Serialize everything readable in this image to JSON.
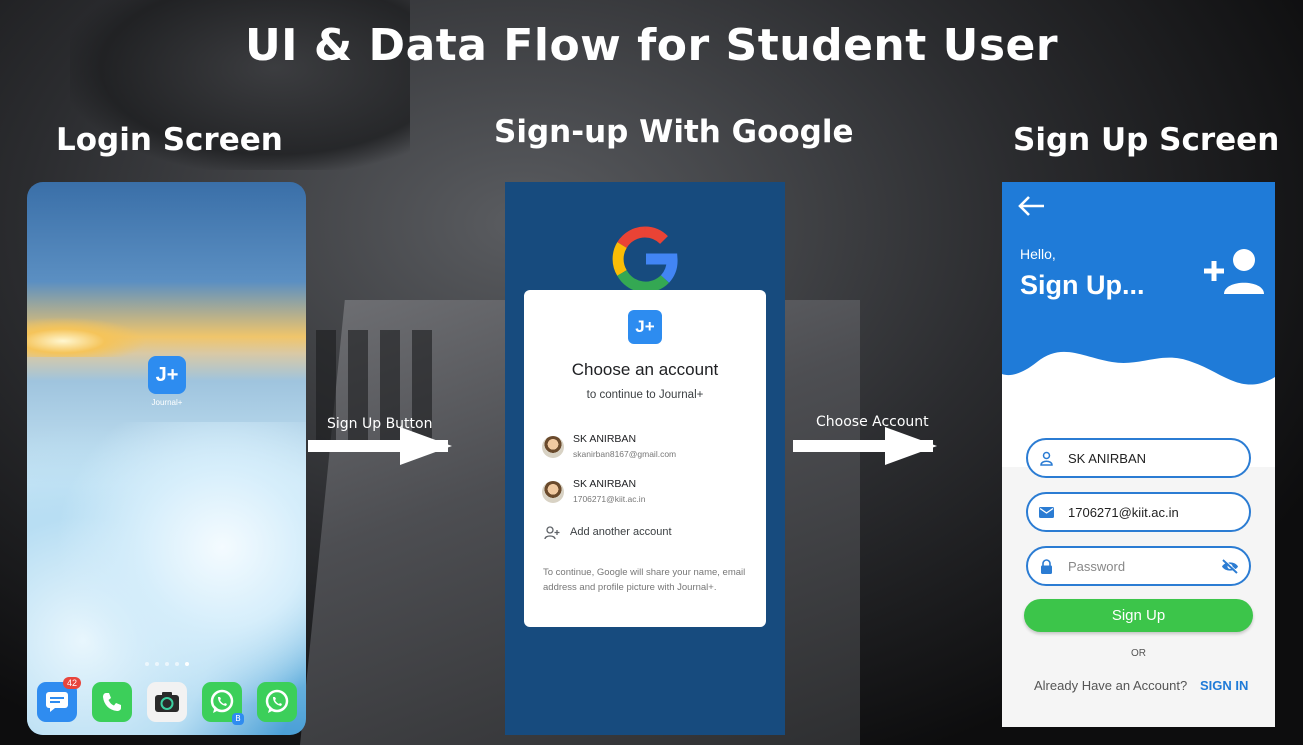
{
  "title": "UI & Data Flow for Student User",
  "sections": {
    "login": "Login Screen",
    "google": "Sign-up With Google",
    "signup": "Sign Up Screen"
  },
  "arrows": {
    "first_label": "Sign Up Button",
    "second_label": "Choose Account"
  },
  "home_screen": {
    "app_icon_text": "J+",
    "app_label": "Journal+",
    "messages_badge": "42",
    "whatsapp_badge": "B",
    "dock_icons": [
      "messages-icon",
      "phone-icon",
      "camera-icon",
      "whatsapp-icon",
      "whatsapp-icon"
    ]
  },
  "google_chooser": {
    "logo_text": "J+",
    "title": "Choose an account",
    "subtitle": "to continue to Journal+",
    "accounts": [
      {
        "name": "SK ANIRBAN",
        "email": "skanirban8167@gmail.com"
      },
      {
        "name": "SK ANIRBAN",
        "email": "1706271@kiit.ac.in"
      }
    ],
    "add_account": "Add another account",
    "note": "To continue, Google will share your name, email address and profile picture with Journal+.",
    "colors": {
      "background": "#174b7e"
    }
  },
  "signup_screen": {
    "hello": "Hello,",
    "title": "Sign Up...",
    "name_value": "SK ANIRBAN",
    "email_value": "1706271@kiit.ac.in",
    "password_placeholder": "Password",
    "signup_button": "Sign Up",
    "or_text": "OR",
    "already_text": "Already Have an Account?",
    "signin_link": "SIGN IN",
    "colors": {
      "header": "#1f7bd8",
      "button": "#3cc54a",
      "field_border": "#2b7cd3"
    }
  }
}
